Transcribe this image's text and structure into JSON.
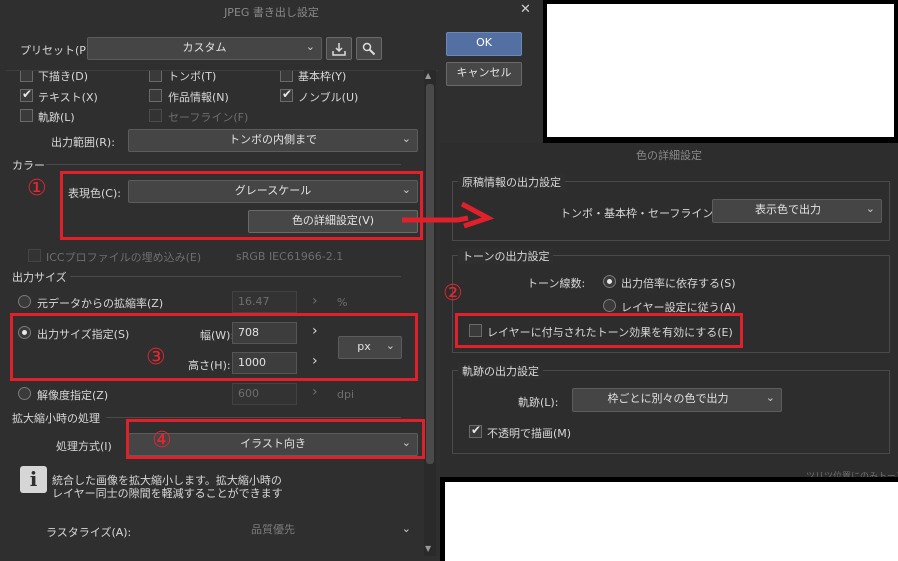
{
  "jpeg_dialog": {
    "title": "JPEG 書き出し設定",
    "close": "✕",
    "preset_label": "プリセット(P):",
    "preset_value": "カスタム",
    "ok": "OK",
    "cancel": "キャンセル",
    "checkboxes": {
      "shitagaki": "下描き(D)",
      "tonbo": "トンボ(T)",
      "kihonwaku": "基本枠(Y)",
      "text": "テキスト(X)",
      "sakuhin": "作品情報(N)",
      "nombre": "ノンブル(U)",
      "kiseki": "軌跡(L)",
      "safeline": "セーフライン(F)"
    },
    "output_range_label": "出力範囲(R):",
    "output_range_value": "トンボの内側まで",
    "color_section": "カラー",
    "expression_label": "表現色(C):",
    "expression_value": "グレースケール",
    "color_detail_button": "色の詳細設定(V)",
    "icc_label": "ICCプロファイルの埋め込み(E)",
    "icc_value": "sRGB IEC61966-2.1",
    "output_size_section": "出力サイズ",
    "scale_label": "元データからの拡縮率(Z)",
    "scale_value": "16.47",
    "scale_unit": "%",
    "size_label": "出力サイズ指定(S)",
    "width_label": "幅(W):",
    "width_value": "708",
    "height_label": "高さ(H):",
    "height_value": "1000",
    "unit_value": "px",
    "resolution_label": "解像度指定(Z)",
    "resolution_value": "600",
    "resolution_unit": "dpi",
    "scaling_section": "拡大縮小時の処理",
    "method_label": "処理方式(I)",
    "method_value": "イラスト向き",
    "info_icon": "i",
    "info_text_1": "統合した画像を拡大縮小します。拡大縮小時の",
    "info_text_2": "レイヤー同士の隙間を軽減することができます",
    "rasterize_label": "ラスタライズ(A):",
    "rasterize_value": "品質優先",
    "arrow_glyph": "›",
    "scroll_up": "▲",
    "scroll_down": "▼"
  },
  "color_dialog": {
    "title": "色の詳細設定",
    "manuscript_group": "原稿情報の出力設定",
    "tonbo_label": "トンボ・基本枠・セーフライン(T):",
    "tonbo_value": "表示色で出力",
    "tone_group": "トーンの出力設定",
    "tone_lines_label": "トーン線数:",
    "tone_option1": "出力倍率に依存する(S)",
    "tone_option2": "レイヤー設定に従う(A)",
    "tone_effect_checkbox": "レイヤーに付与されたトーン効果を有効にする(E)",
    "kiseki_group": "軌跡の出力設定",
    "kiseki_label": "軌跡(L):",
    "kiseki_value": "枠ごとに別々の色で出力",
    "opaque_checkbox": "不透明で描画(M)",
    "bottom_cut_text": "ツリツ位置にのみトーン"
  },
  "annotations": {
    "n1": "①",
    "n2": "②",
    "n3": "③",
    "n4": "④",
    "accent_red": "#e0202a"
  }
}
